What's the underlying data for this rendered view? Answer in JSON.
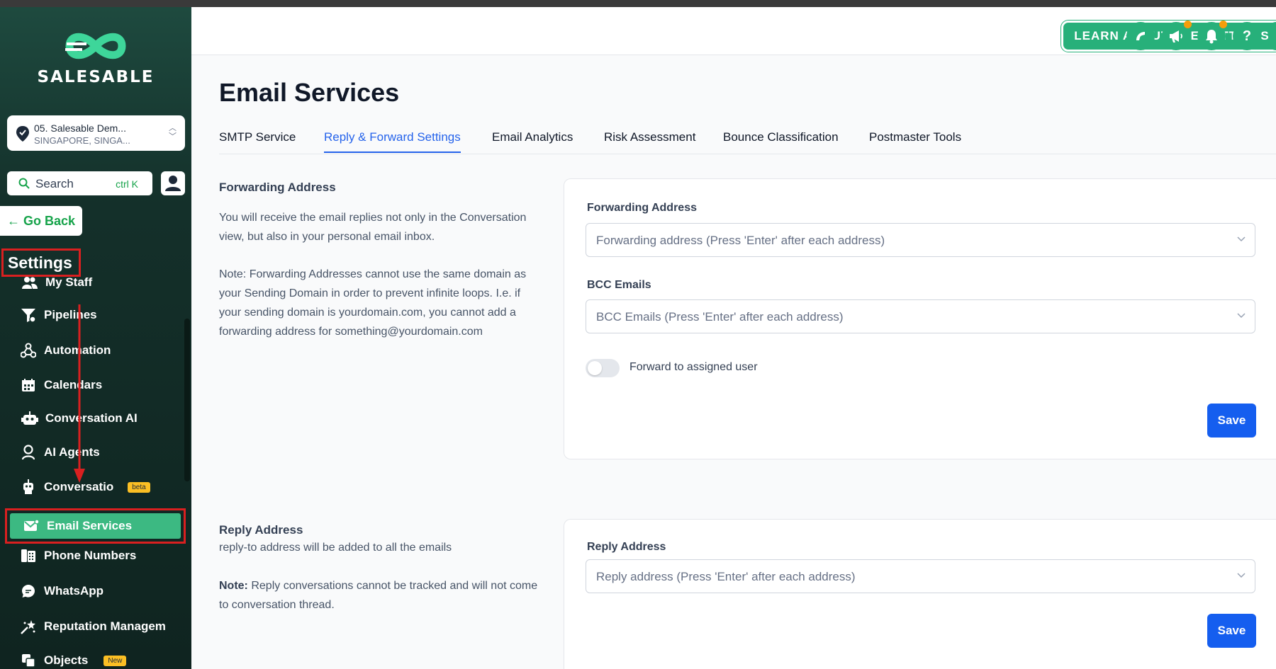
{
  "brand": {
    "name": "SALESABLE"
  },
  "account": {
    "name": "05. Salesable Dem...",
    "location": "SINGAPORE, SINGA..."
  },
  "search": {
    "label": "Search",
    "shortcut": "ctrl K"
  },
  "go_back": "Go Back",
  "settings_title": "Settings",
  "nav": [
    {
      "label": "My Staff",
      "icon": "users-icon"
    },
    {
      "label": "Pipelines",
      "icon": "funnel-icon"
    },
    {
      "label": "Automation",
      "icon": "automation-icon"
    },
    {
      "label": "Calendars",
      "icon": "calendar-icon"
    },
    {
      "label": "Conversation AI",
      "icon": "robot-icon"
    },
    {
      "label": "AI Agents",
      "icon": "agent-icon"
    },
    {
      "label": "Conversatio",
      "icon": "bot-icon",
      "badge": "beta"
    },
    {
      "label": "Email Services",
      "icon": "mail-icon",
      "active": true
    },
    {
      "label": "Phone Numbers",
      "icon": "phone-book-icon"
    },
    {
      "label": "WhatsApp",
      "icon": "whatsapp-icon"
    },
    {
      "label": "Reputation Managem",
      "icon": "star-icon"
    },
    {
      "label": "Objects",
      "icon": "objects-icon",
      "badge": "New"
    }
  ],
  "header": {
    "learn_button": "LEARN ABOUT THE SETTINGS",
    "icons": [
      "phone-icon",
      "megaphone-icon",
      "bell-icon",
      "help-icon"
    ],
    "help_glyph": "?"
  },
  "page": {
    "title": "Email Services",
    "tabs": [
      "SMTP Service",
      "Reply & Forward Settings",
      "Email Analytics",
      "Risk Assessment",
      "Bounce Classification",
      "Postmaster Tools"
    ],
    "active_tab": "Reply & Forward Settings"
  },
  "forwarding": {
    "title": "Forwarding Address",
    "desc1": "You will receive the email replies not only in the Conversation view, but also in your personal email inbox.",
    "desc2": "Note: Forwarding Addresses cannot use the same domain as your Sending Domain in order to prevent infinite loops. I.e. if your sending domain is yourdomain.com, you cannot add a forwarding address for something@yourdomain.com",
    "field_label": "Forwarding Address",
    "field_placeholder": "Forwarding address (Press 'Enter' after each address)",
    "bcc_label": "BCC Emails",
    "bcc_placeholder": "BCC Emails (Press 'Enter' after each address)",
    "toggle_label": "Forward to assigned user",
    "toggle_on": false,
    "save": "Save"
  },
  "reply": {
    "title": "Reply Address",
    "desc": "reply-to address will be added to all the emails",
    "note_label": "Note:",
    "note_text": " Reply conversations cannot be tracked and will not come to conversation thread.",
    "field_label": "Reply Address",
    "field_placeholder": "Reply address (Press 'Enter' after each address)",
    "save": "Save"
  },
  "colors": {
    "brand_green": "#27b07a",
    "active_nav": "#3cb982",
    "primary_blue": "#155eef",
    "highlight_red": "#d92020",
    "badge_yellow": "#fbbf24"
  }
}
